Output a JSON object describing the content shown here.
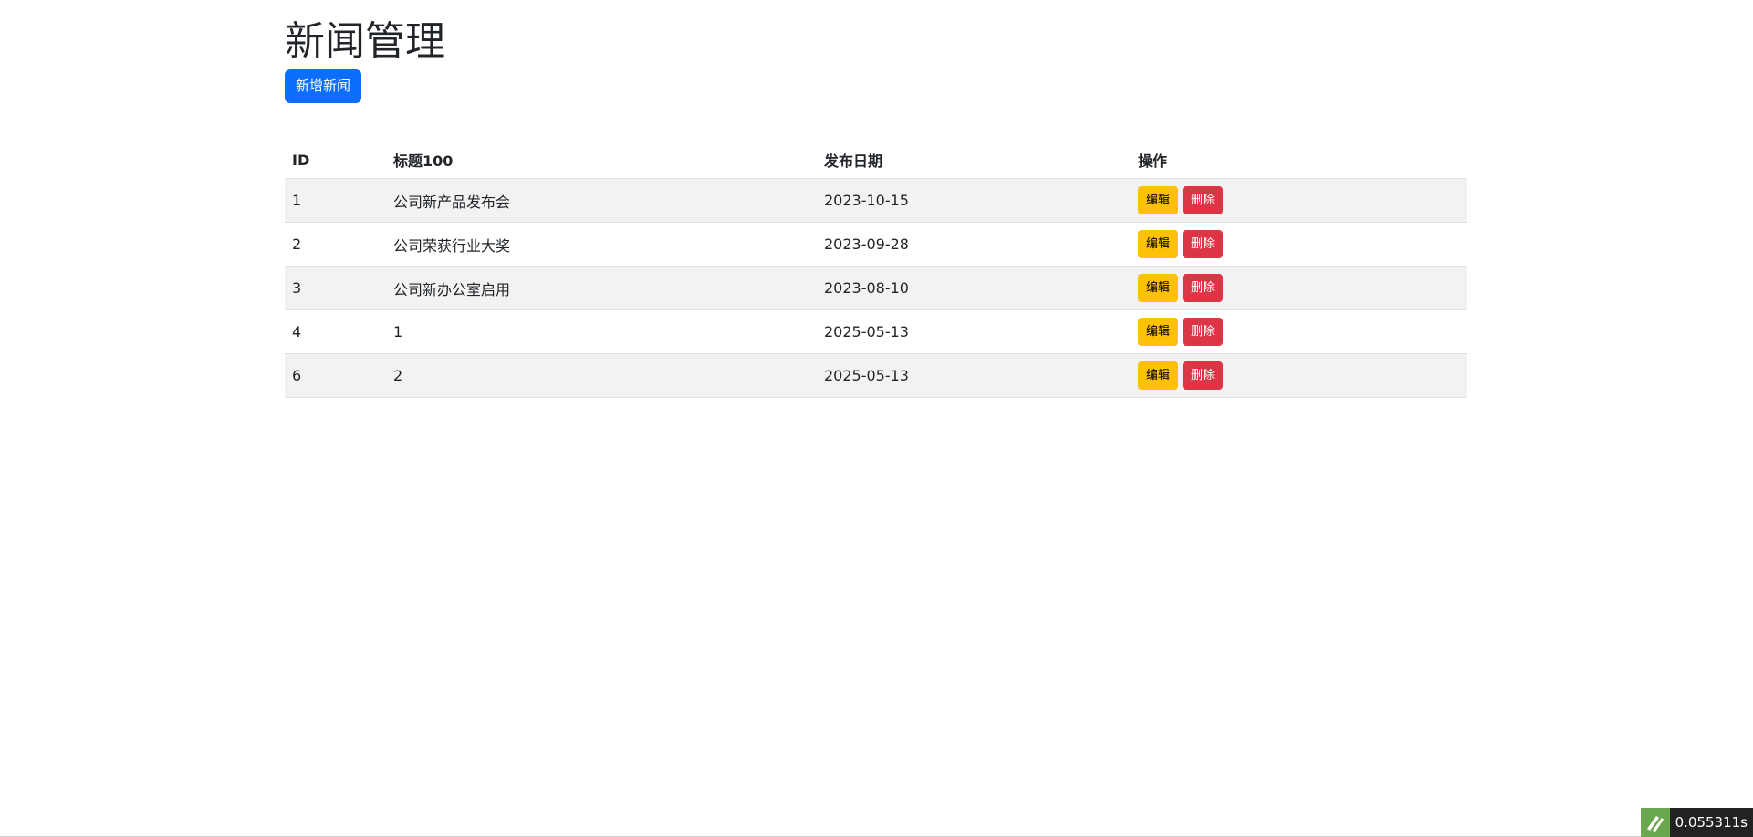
{
  "page": {
    "title": "新闻管理",
    "add_button_label": "新增新闻"
  },
  "table": {
    "headers": {
      "id": "ID",
      "title": "标题100",
      "date": "发布日期",
      "actions": "操作"
    },
    "rows": [
      {
        "id": "1",
        "title": "公司新产品发布会",
        "date": "2023-10-15",
        "edit": "编辑",
        "delete": "删除"
      },
      {
        "id": "2",
        "title": "公司荣获行业大奖",
        "date": "2023-09-28",
        "edit": "编辑",
        "delete": "删除"
      },
      {
        "id": "3",
        "title": "公司新办公室启用",
        "date": "2023-08-10",
        "edit": "编辑",
        "delete": "删除"
      },
      {
        "id": "4",
        "title": "1",
        "date": "2025-05-13",
        "edit": "编辑",
        "delete": "删除"
      },
      {
        "id": "6",
        "title": "2",
        "date": "2025-05-13",
        "edit": "编辑",
        "delete": "删除"
      }
    ]
  },
  "debug_bar": {
    "time": "0.055311s",
    "logo_icon": "thinkphp-logo-icon"
  },
  "colors": {
    "primary": "#0d6efd",
    "warning": "#ffc107",
    "danger": "#dc3545",
    "stripe": "#f2f2f2",
    "debug_logo": "#6aa84f"
  }
}
